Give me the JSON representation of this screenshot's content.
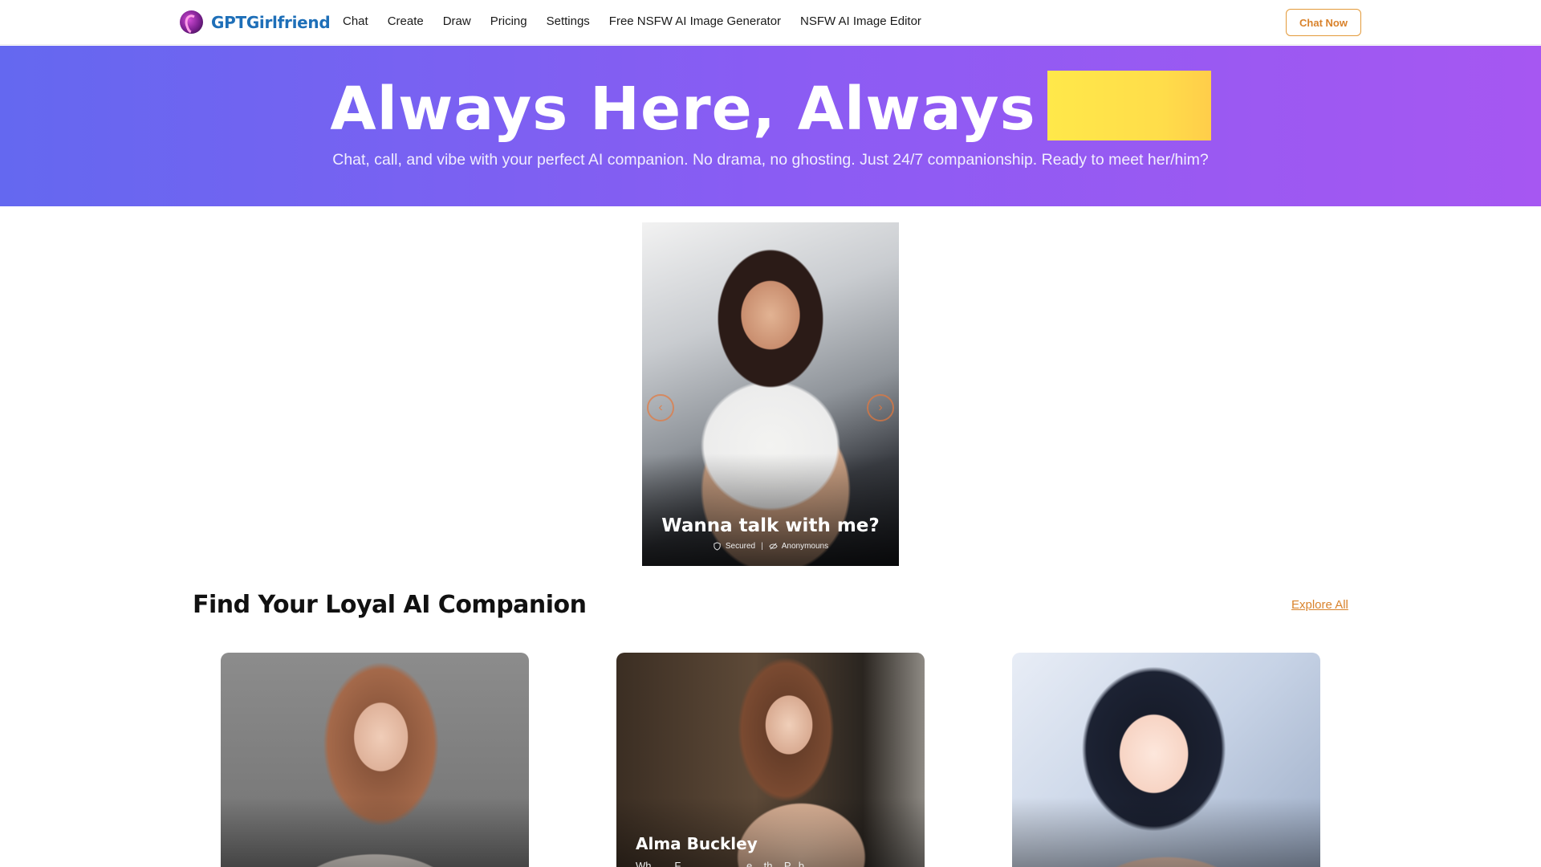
{
  "nav": {
    "brand": "GPTGirlfriend",
    "links": [
      "Chat",
      "Create",
      "Draw",
      "Pricing",
      "Settings",
      "Free NSFW AI Image Generator",
      "NSFW AI Image Editor"
    ],
    "cta": "Chat Now"
  },
  "hero": {
    "title": "Always Here, Always",
    "subtitle": "Chat, call, and vibe with your perfect AI companion. No drama, no ghosting. Just 24/7 companionship. Ready to meet her/him?",
    "highlight_color": "#ffe04a"
  },
  "featured": {
    "title": "Wanna talk with me?",
    "badge_secured": "Secured",
    "badge_anonymous": "Anonymouns"
  },
  "companions": {
    "section_title": "Find Your Loyal AI Companion",
    "explore_label": "Explore All",
    "cards": [
      {
        "name": "",
        "desc": ""
      },
      {
        "name": "Alma Buckley",
        "desc": "Wh... ... F... ... ... ... ... ...e ...th... P...b..."
      },
      {
        "name": "",
        "desc": ""
      }
    ]
  },
  "colors": {
    "brand": "#1e6fb8",
    "accent": "#d9822b",
    "hero_gradient_start": "#6468f0",
    "hero_gradient_end": "#a657f2"
  },
  "icons": {
    "brand": "logo-icon",
    "secured": "shield-icon",
    "anonymous": "eye-off-icon",
    "carousel_prev": "chevron-left-icon",
    "carousel_next": "chevron-right-icon"
  }
}
